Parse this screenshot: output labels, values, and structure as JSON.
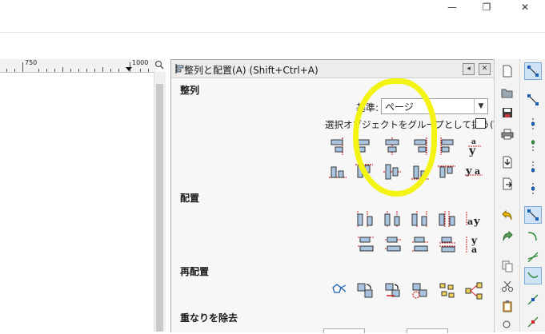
{
  "window": {
    "minimize": "—",
    "restore": "❐",
    "close": "✕"
  },
  "ruler": {
    "labels": [
      "750",
      "1000"
    ]
  },
  "dialog": {
    "title": "整列と配置(A) (Shift+Ctrl+A)",
    "sections": {
      "align": "整列",
      "distribute": "配置",
      "rearrange": "再配置",
      "remove_overlap": "重なりを除去"
    },
    "relative_to": {
      "label": "基準:",
      "value": "ページ"
    },
    "group_label": "選択オブジェクトをグループとして扱う(T):",
    "group_checked": false
  },
  "colors": {
    "accent": "#1a5fb4",
    "highlight": "#f3f314",
    "guide": "#d12020",
    "box": "#a8c4e0"
  }
}
